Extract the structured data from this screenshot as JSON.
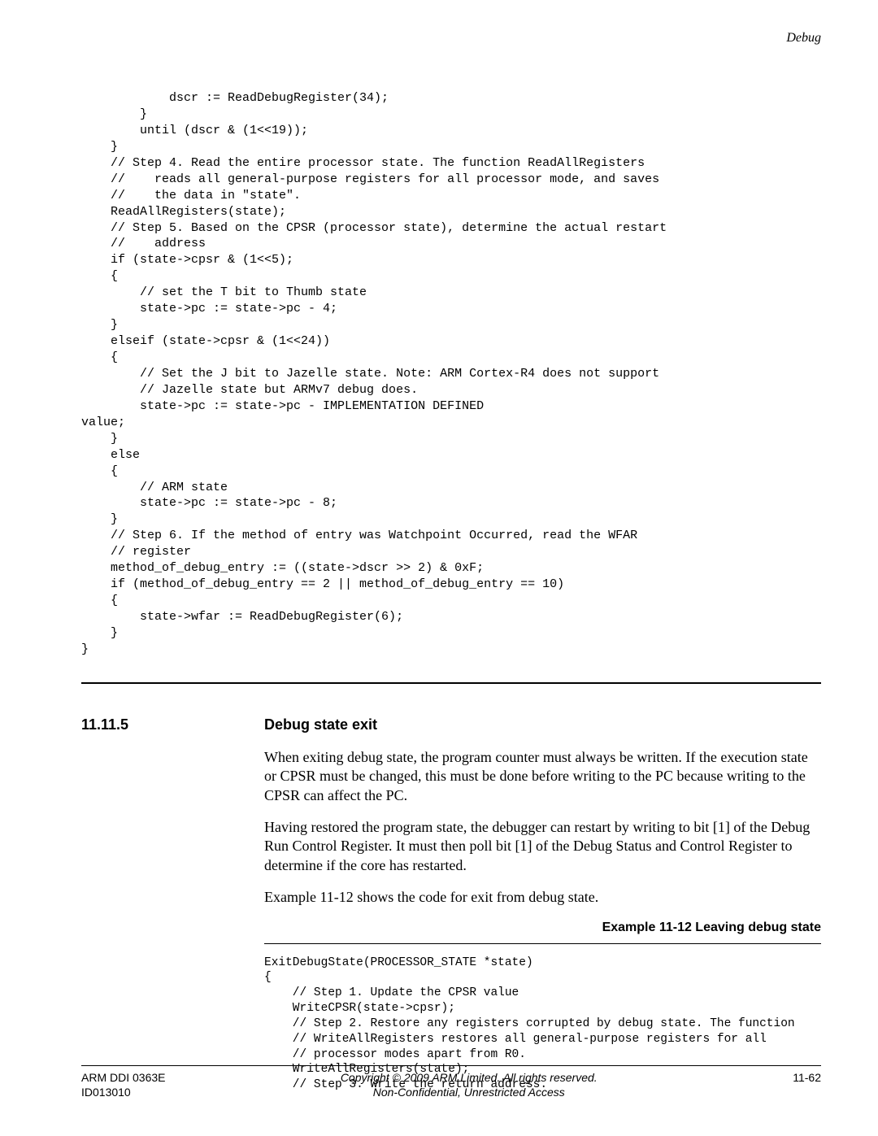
{
  "header": {
    "running": "Debug"
  },
  "code1": "            dscr := ReadDebugRegister(34);\n        }\n        until (dscr & (1<<19));\n    }\n    // Step 4. Read the entire processor state. The function ReadAllRegisters\n    //    reads all general-purpose registers for all processor mode, and saves\n    //    the data in \"state\".\n    ReadAllRegisters(state);\n    // Step 5. Based on the CPSR (processor state), determine the actual restart\n    //    address\n    if (state->cpsr & (1<<5);\n    {\n        // set the T bit to Thumb state\n        state->pc := state->pc - 4;\n    }\n    elseif (state->cpsr & (1<<24))\n    {\n        // Set the J bit to Jazelle state. Note: ARM Cortex-R4 does not support\n        // Jazelle state but ARMv7 debug does.\n        state->pc := state->pc - IMPLEMENTATION DEFINED\nvalue;\n    }\n    else\n    {\n        // ARM state\n        state->pc := state->pc - 8;\n    }\n    // Step 6. If the method of entry was Watchpoint Occurred, read the WFAR\n    // register\n    method_of_debug_entry := ((state->dscr >> 2) & 0xF;\n    if (method_of_debug_entry == 2 || method_of_debug_entry == 10)\n    {\n        state->wfar := ReadDebugRegister(6);\n    }\n}",
  "section": {
    "number": "11.11.5",
    "title": "Debug state exit",
    "p1": "When exiting debug state, the program counter must always be written. If the execution state or CPSR must be changed, this must be done before writing to the PC because writing to the CPSR can affect the PC.",
    "p2": "Having restored the program state, the debugger can restart by writing to bit [1] of the Debug Run Control Register. It must then poll bit [1] of the Debug Status and Control Register to determine if the core has restarted.",
    "p3": "Example 11-12 shows the code for exit from debug state."
  },
  "example": {
    "caption": "Example 11-12 Leaving debug state",
    "code": "ExitDebugState(PROCESSOR_STATE *state)\n{\n    // Step 1. Update the CPSR value\n    WriteCPSR(state->cpsr);\n    // Step 2. Restore any registers corrupted by debug state. The function\n    // WriteAllRegisters restores all general-purpose registers for all\n    // processor modes apart from R0.\n    WriteAllRegisters(state);\n    // Step 3. Write the return address."
  },
  "footer": {
    "left1": "ARM DDI 0363E",
    "left2": "ID013010",
    "center1": "Copyright © 2009 ARM Limited. All rights reserved.",
    "center2": "Non-Confidential, Unrestricted Access",
    "right": "11-62"
  }
}
